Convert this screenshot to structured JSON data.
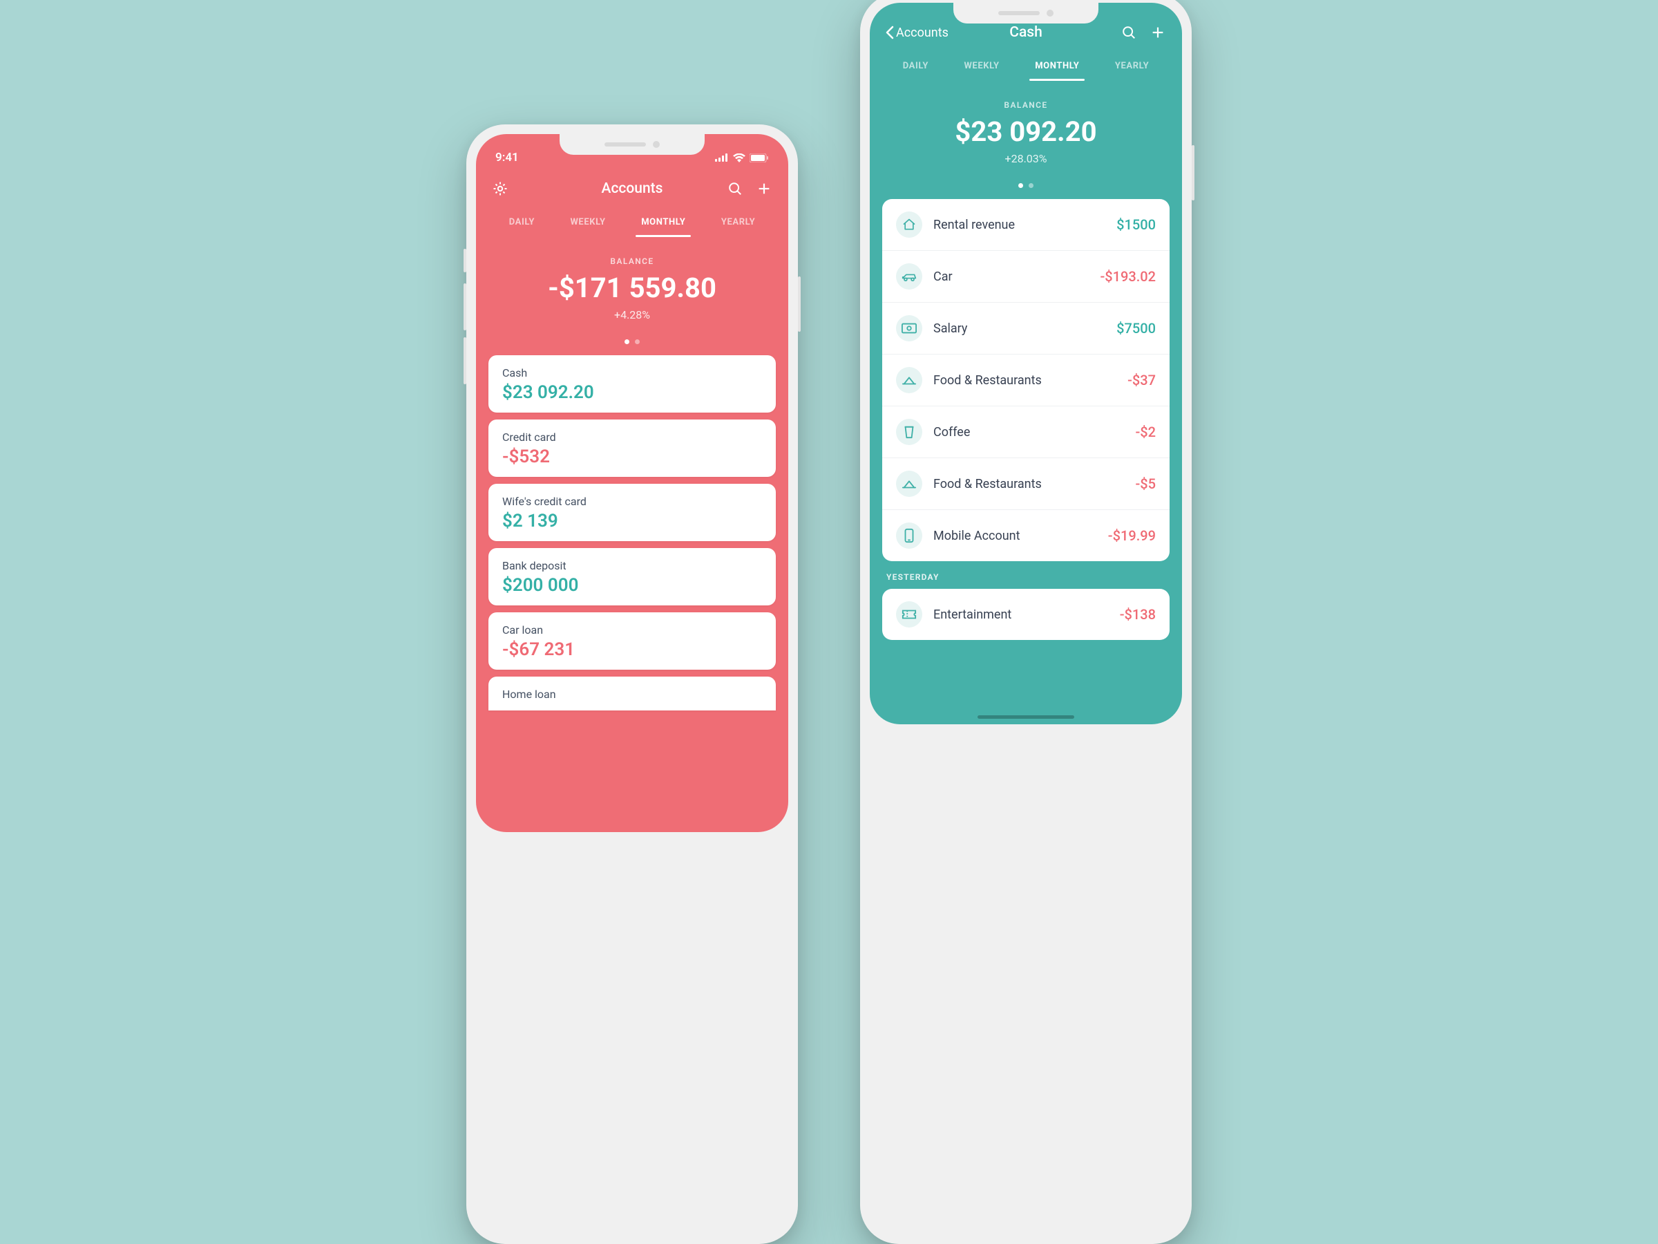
{
  "colors": {
    "red": "#ef6d75",
    "teal": "#46b1a9",
    "pos": "#34b0a6",
    "neg": "#ef6a74"
  },
  "left": {
    "statusTime": "9:41",
    "title": "Accounts",
    "tabs": [
      "DAILY",
      "WEEKLY",
      "MONTHLY",
      "YEARLY"
    ],
    "activeTab": 2,
    "balanceLabel": "BALANCE",
    "balanceValue": "-$171 559.80",
    "balanceDelta": "+4.28%",
    "accounts": [
      {
        "name": "Cash",
        "amount": "$23 092.20",
        "sign": "pos"
      },
      {
        "name": "Credit card",
        "amount": "-$532",
        "sign": "neg"
      },
      {
        "name": "Wife's credit card",
        "amount": "$2 139",
        "sign": "pos"
      },
      {
        "name": "Bank deposit",
        "amount": "$200 000",
        "sign": "pos"
      },
      {
        "name": "Car loan",
        "amount": "-$67 231",
        "sign": "neg"
      },
      {
        "name": "Home loan",
        "amount": "",
        "sign": "neg"
      }
    ]
  },
  "right": {
    "backLabel": "Accounts",
    "title": "Cash",
    "tabs": [
      "DAILY",
      "WEEKLY",
      "MONTHLY",
      "YEARLY"
    ],
    "activeTab": 2,
    "balanceLabel": "BALANCE",
    "balanceValue": "$23 092.20",
    "balanceDelta": "+28.03%",
    "transactions": [
      {
        "icon": "home",
        "name": "Rental revenue",
        "amount": "$1500",
        "sign": "pos"
      },
      {
        "icon": "car",
        "name": "Car",
        "amount": "-$193.02",
        "sign": "neg"
      },
      {
        "icon": "cash",
        "name": "Salary",
        "amount": "$7500",
        "sign": "pos"
      },
      {
        "icon": "food",
        "name": "Food & Restaurants",
        "amount": "-$37",
        "sign": "neg"
      },
      {
        "icon": "coffee",
        "name": "Coffee",
        "amount": "-$2",
        "sign": "neg"
      },
      {
        "icon": "food",
        "name": "Food & Restaurants",
        "amount": "-$5",
        "sign": "neg"
      },
      {
        "icon": "mobile",
        "name": "Mobile Account",
        "amount": "-$19.99",
        "sign": "neg"
      }
    ],
    "sectionYesterday": "YESTERDAY",
    "yesterday": [
      {
        "icon": "ticket",
        "name": "Entertainment",
        "amount": "-$138",
        "sign": "neg"
      }
    ]
  }
}
